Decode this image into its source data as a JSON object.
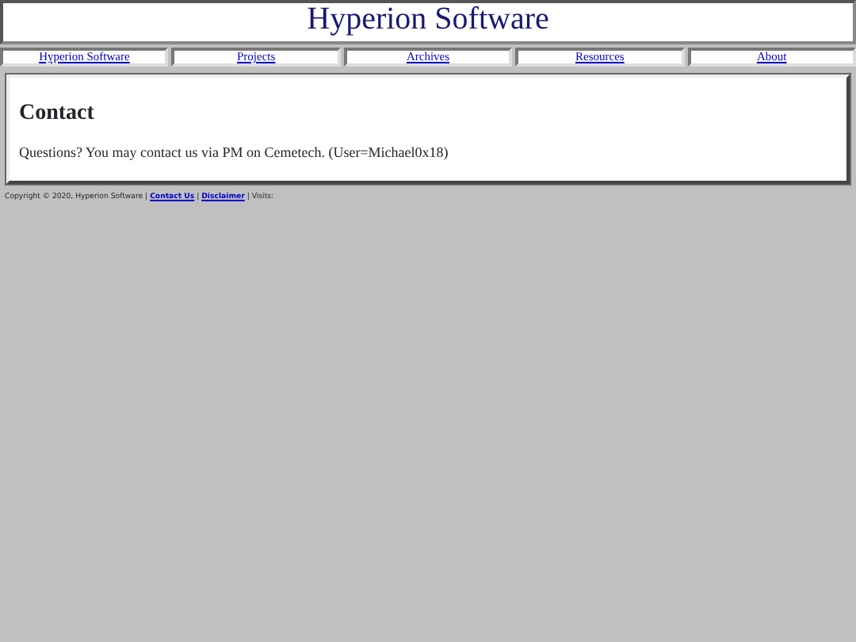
{
  "header": {
    "title": "Hyperion Software"
  },
  "nav": [
    {
      "label": "Hyperion Software"
    },
    {
      "label": "Projects"
    },
    {
      "label": "Archives"
    },
    {
      "label": "Resources"
    },
    {
      "label": "About"
    }
  ],
  "content": {
    "heading": "Contact",
    "text": "Questions? You may contact us via PM on Cemetech. (User=Michael0x18)"
  },
  "footer": {
    "copyright": "Copyright © 2020, Hyperion Software |",
    "links": [
      "Contact Us",
      "Disclaimer"
    ],
    "separator": "|",
    "visits": "| Visits:"
  }
}
